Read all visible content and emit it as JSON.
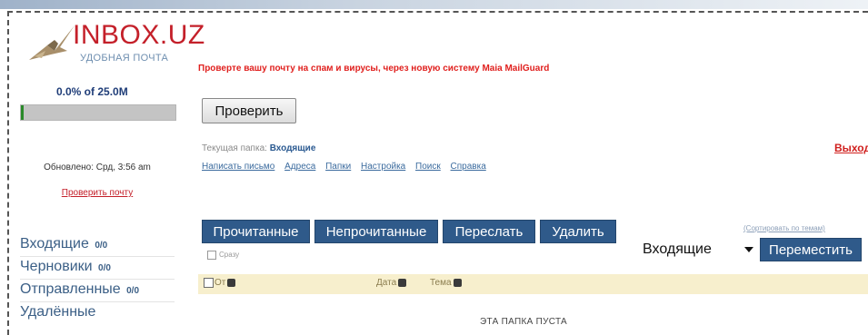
{
  "brand": {
    "title": "INBOX.UZ",
    "subtitle": "УДОБНАЯ ПОЧТА",
    "colors": {
      "title": "#c4202a",
      "accent": "#2f5a8a"
    }
  },
  "sidebar": {
    "quota_text": "0.0% of 25.0M",
    "quota_fraction": 0.0,
    "updated_text": "Обновлено: Срд, 3:56 am",
    "check_mail_label": "Проверить почту",
    "folders": [
      {
        "label": "Входящие",
        "count": "0/0"
      },
      {
        "label": "Черновики",
        "count": "0/0"
      },
      {
        "label": "Отправленные",
        "count": "0/0"
      },
      {
        "label": "Удалённые",
        "count": ""
      }
    ]
  },
  "main": {
    "spam_notice": "Проверте вашу почту на спам и вирусы, через новую систему Maia MailGuard",
    "check_button": "Проверить",
    "current_folder_prefix": "Текущая папка:",
    "current_folder_name": "Входящие",
    "logout_label": "Выход",
    "nav_links": [
      "Написать письмо",
      "Адреса",
      "Папки",
      "Настройка",
      "Поиск",
      "Справка"
    ],
    "actions": [
      "Прочитанные",
      "Непрочитанные",
      "Переслать",
      "Удалить"
    ],
    "sort_link": "(Сортировать по темам)",
    "immediately_label": "Сразу",
    "folder_select_value": "Входящие",
    "move_button": "Переместить",
    "columns": {
      "from": "От",
      "date": "Дата",
      "subject": "Тема"
    },
    "empty_message": "ЭТА ПАПКА ПУСТА"
  }
}
